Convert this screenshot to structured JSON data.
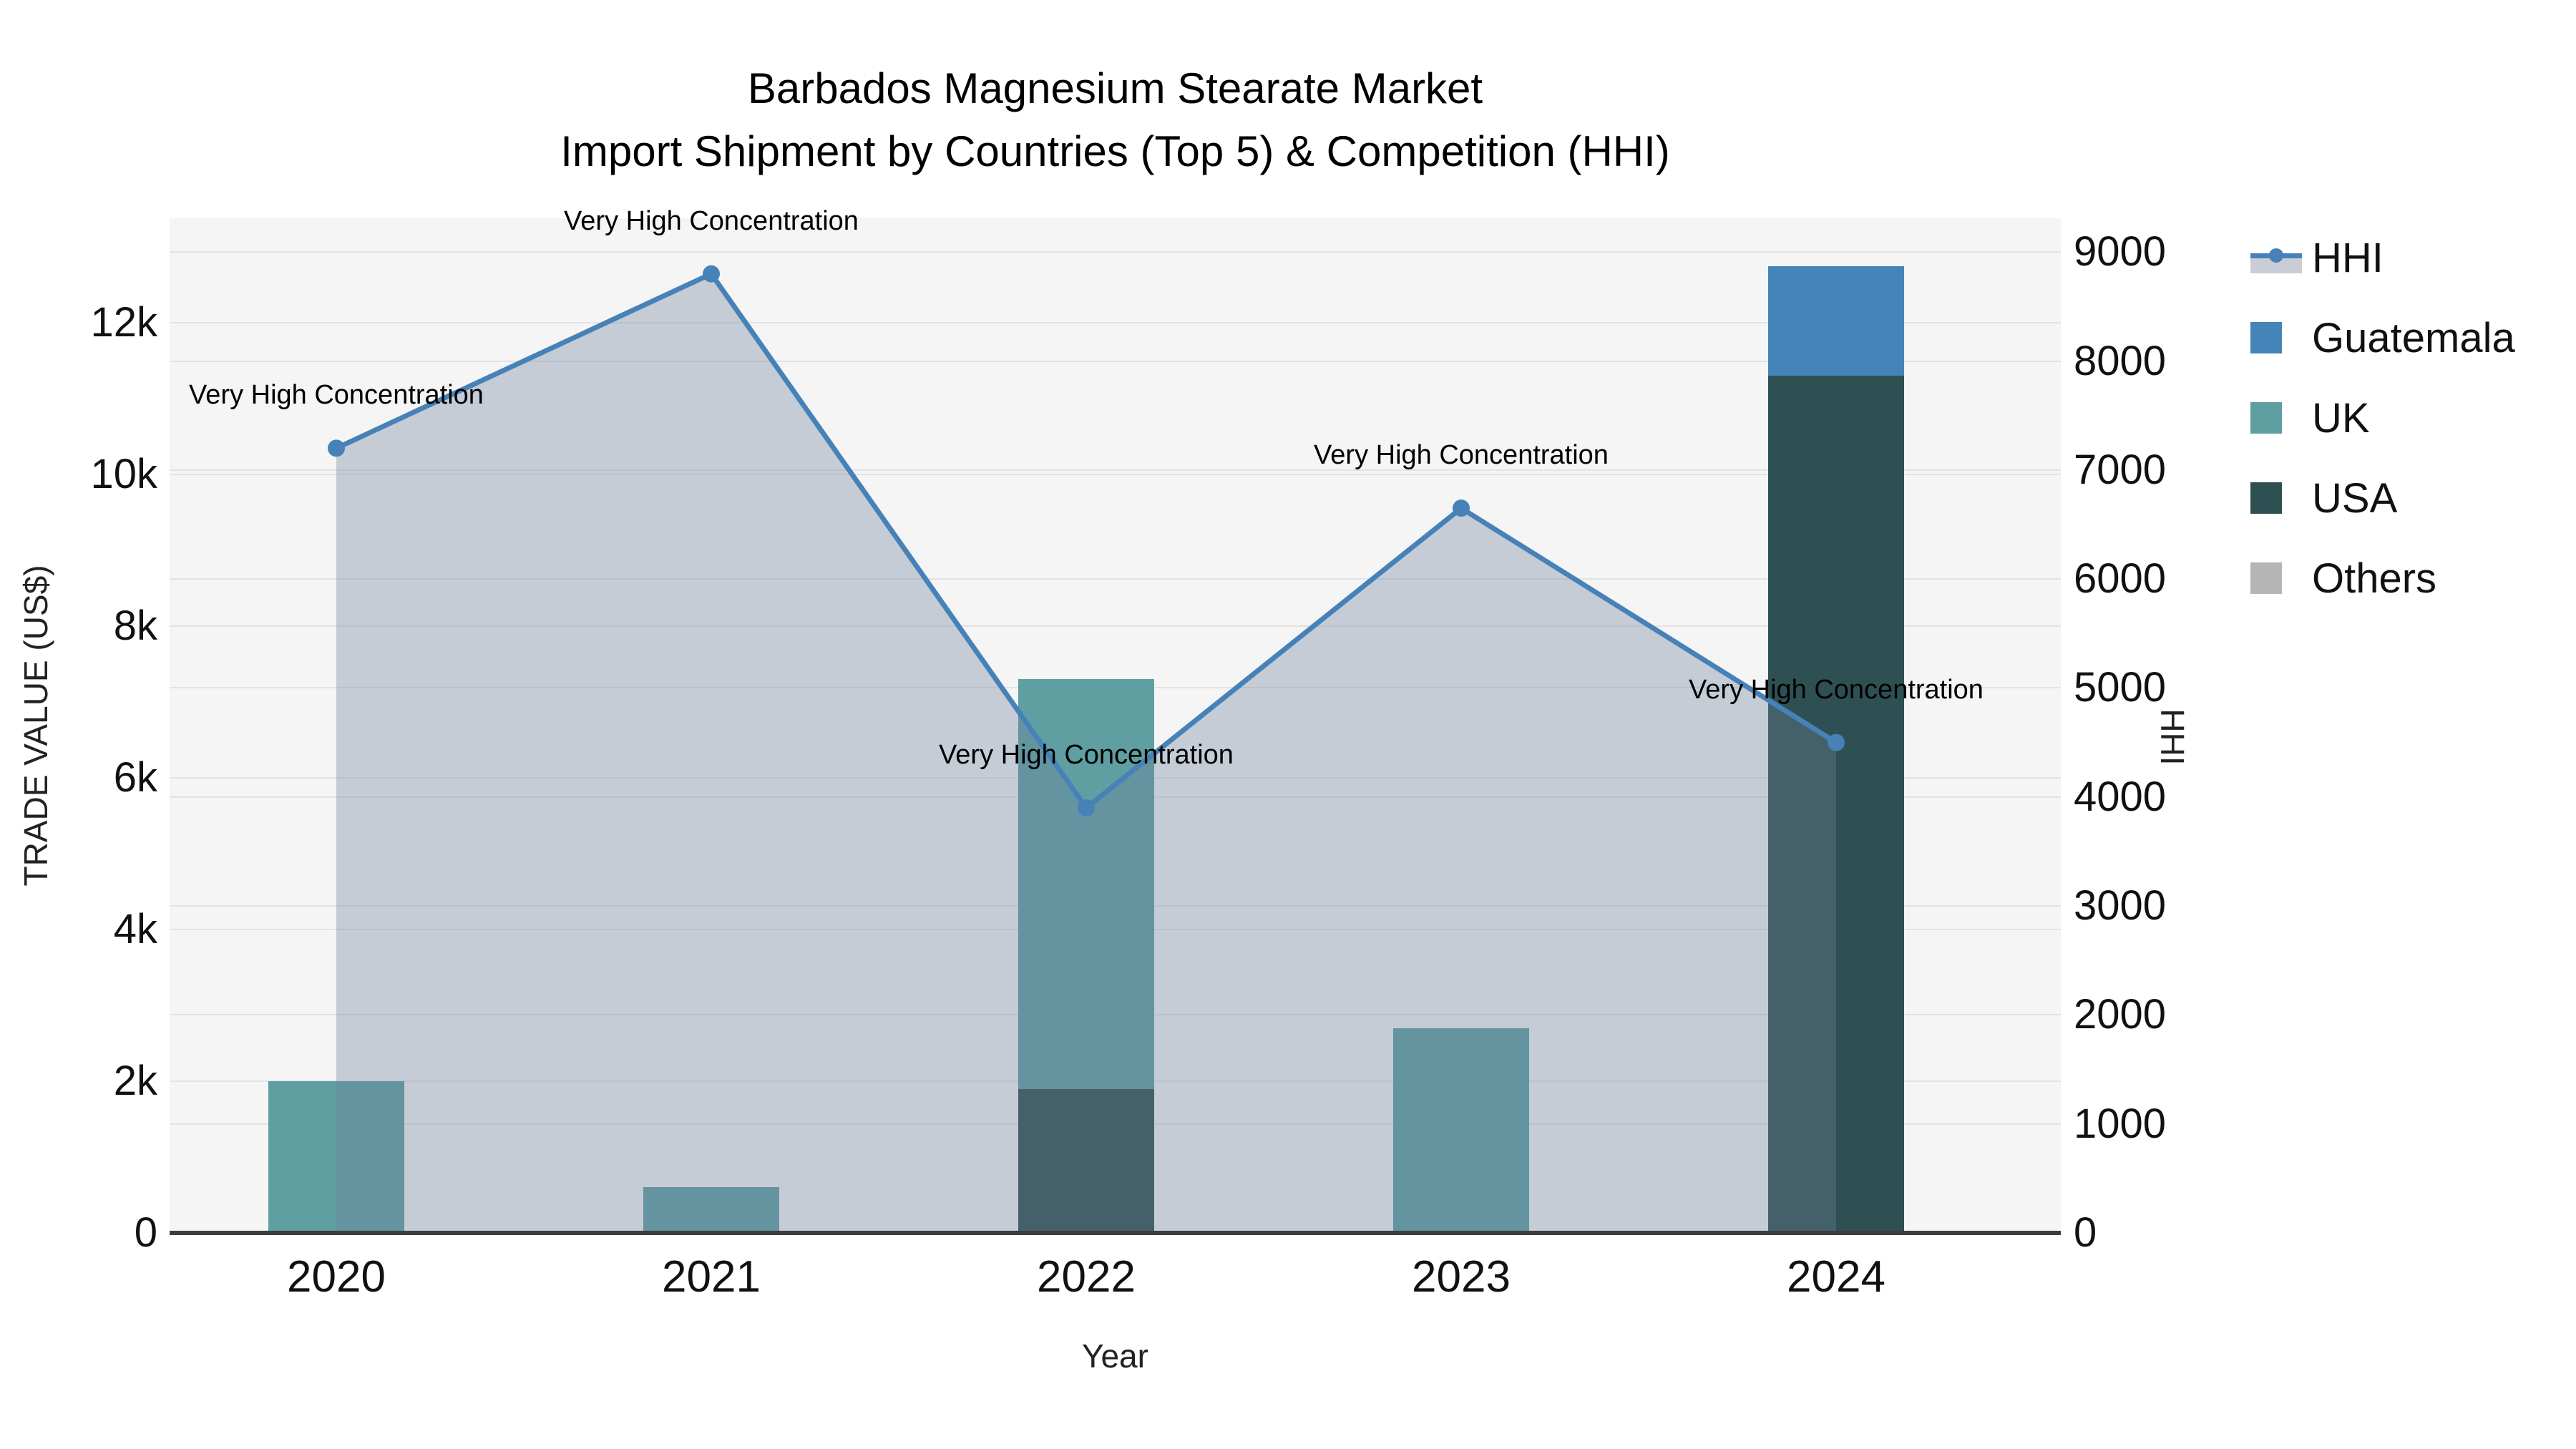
{
  "title": {
    "line1": "Barbados Magnesium Stearate Market",
    "line2": "Import Shipment by Countries (Top 5) & Competition (HHI)"
  },
  "axes": {
    "x": {
      "title": "Year",
      "tick_labels": [
        "2020",
        "2021",
        "2022",
        "2023",
        "2024"
      ]
    },
    "y_left": {
      "title": "TRADE VALUE (US$)",
      "tick_labels": [
        "0",
        "2k",
        "4k",
        "6k",
        "8k",
        "10k",
        "12k"
      ],
      "tick_values": [
        0,
        2000,
        4000,
        6000,
        8000,
        10000,
        12000
      ]
    },
    "y_right": {
      "title": "HHI",
      "tick_labels": [
        "0",
        "1000",
        "2000",
        "3000",
        "4000",
        "5000",
        "6000",
        "7000",
        "8000",
        "9000"
      ],
      "tick_values": [
        0,
        1000,
        2000,
        3000,
        4000,
        5000,
        6000,
        7000,
        8000,
        9000
      ]
    }
  },
  "legend": {
    "items": [
      {
        "label": "HHI",
        "swatch": "line-marker-area",
        "color": "#4682b8"
      },
      {
        "label": "Guatemala",
        "swatch": "square",
        "color": "#4484b8"
      },
      {
        "label": "UK",
        "swatch": "square",
        "color": "#5f9fa1"
      },
      {
        "label": "USA",
        "swatch": "square",
        "color": "#2f5052"
      },
      {
        "label": "Others",
        "swatch": "square",
        "color": "#b5b5b5"
      }
    ]
  },
  "annotation_text": "Very High Concentration",
  "chart_data": {
    "type": "combo-stacked-bar-line",
    "title": "Barbados Magnesium Stearate Market — Import Shipment by Countries (Top 5) & Competition (HHI)",
    "xlabel": "Year",
    "ylabel_left": "TRADE VALUE (US$)",
    "ylabel_right": "HHI",
    "categories": [
      "2020",
      "2021",
      "2022",
      "2023",
      "2024"
    ],
    "bar_series": [
      {
        "name": "Guatemala",
        "color": "#4484b8",
        "values": [
          0,
          0,
          0,
          0,
          1450
        ]
      },
      {
        "name": "UK",
        "color": "#5f9fa1",
        "values": [
          2000,
          600,
          5400,
          2700,
          0
        ]
      },
      {
        "name": "USA",
        "color": "#2f5052",
        "values": [
          0,
          0,
          1900,
          0,
          11300
        ]
      },
      {
        "name": "Others",
        "color": "#b5b5b5",
        "values": [
          0,
          0,
          0,
          0,
          0
        ]
      }
    ],
    "stack_order_bottom_to_top": [
      "USA",
      "UK",
      "Guatemala",
      "Others"
    ],
    "line_series": {
      "name": "HHI",
      "axis": "right",
      "color": "#4682b8",
      "area_fill": "rgba(110,128,156,0.35)",
      "values": [
        7200,
        8800,
        3900,
        6650,
        4500
      ],
      "point_annotations": [
        "Very High Concentration",
        "Very High Concentration",
        "Very High Concentration",
        "Very High Concentration",
        "Very High Concentration"
      ]
    },
    "y_left_range": [
      0,
      13380
    ],
    "y_right_range": [
      0,
      9310
    ],
    "grid": true,
    "legend_position": "right-top",
    "plot_bg": "#f5f5f5",
    "grid_color": "#e3e3e3",
    "axis_line_color": "#3c3c3c"
  }
}
